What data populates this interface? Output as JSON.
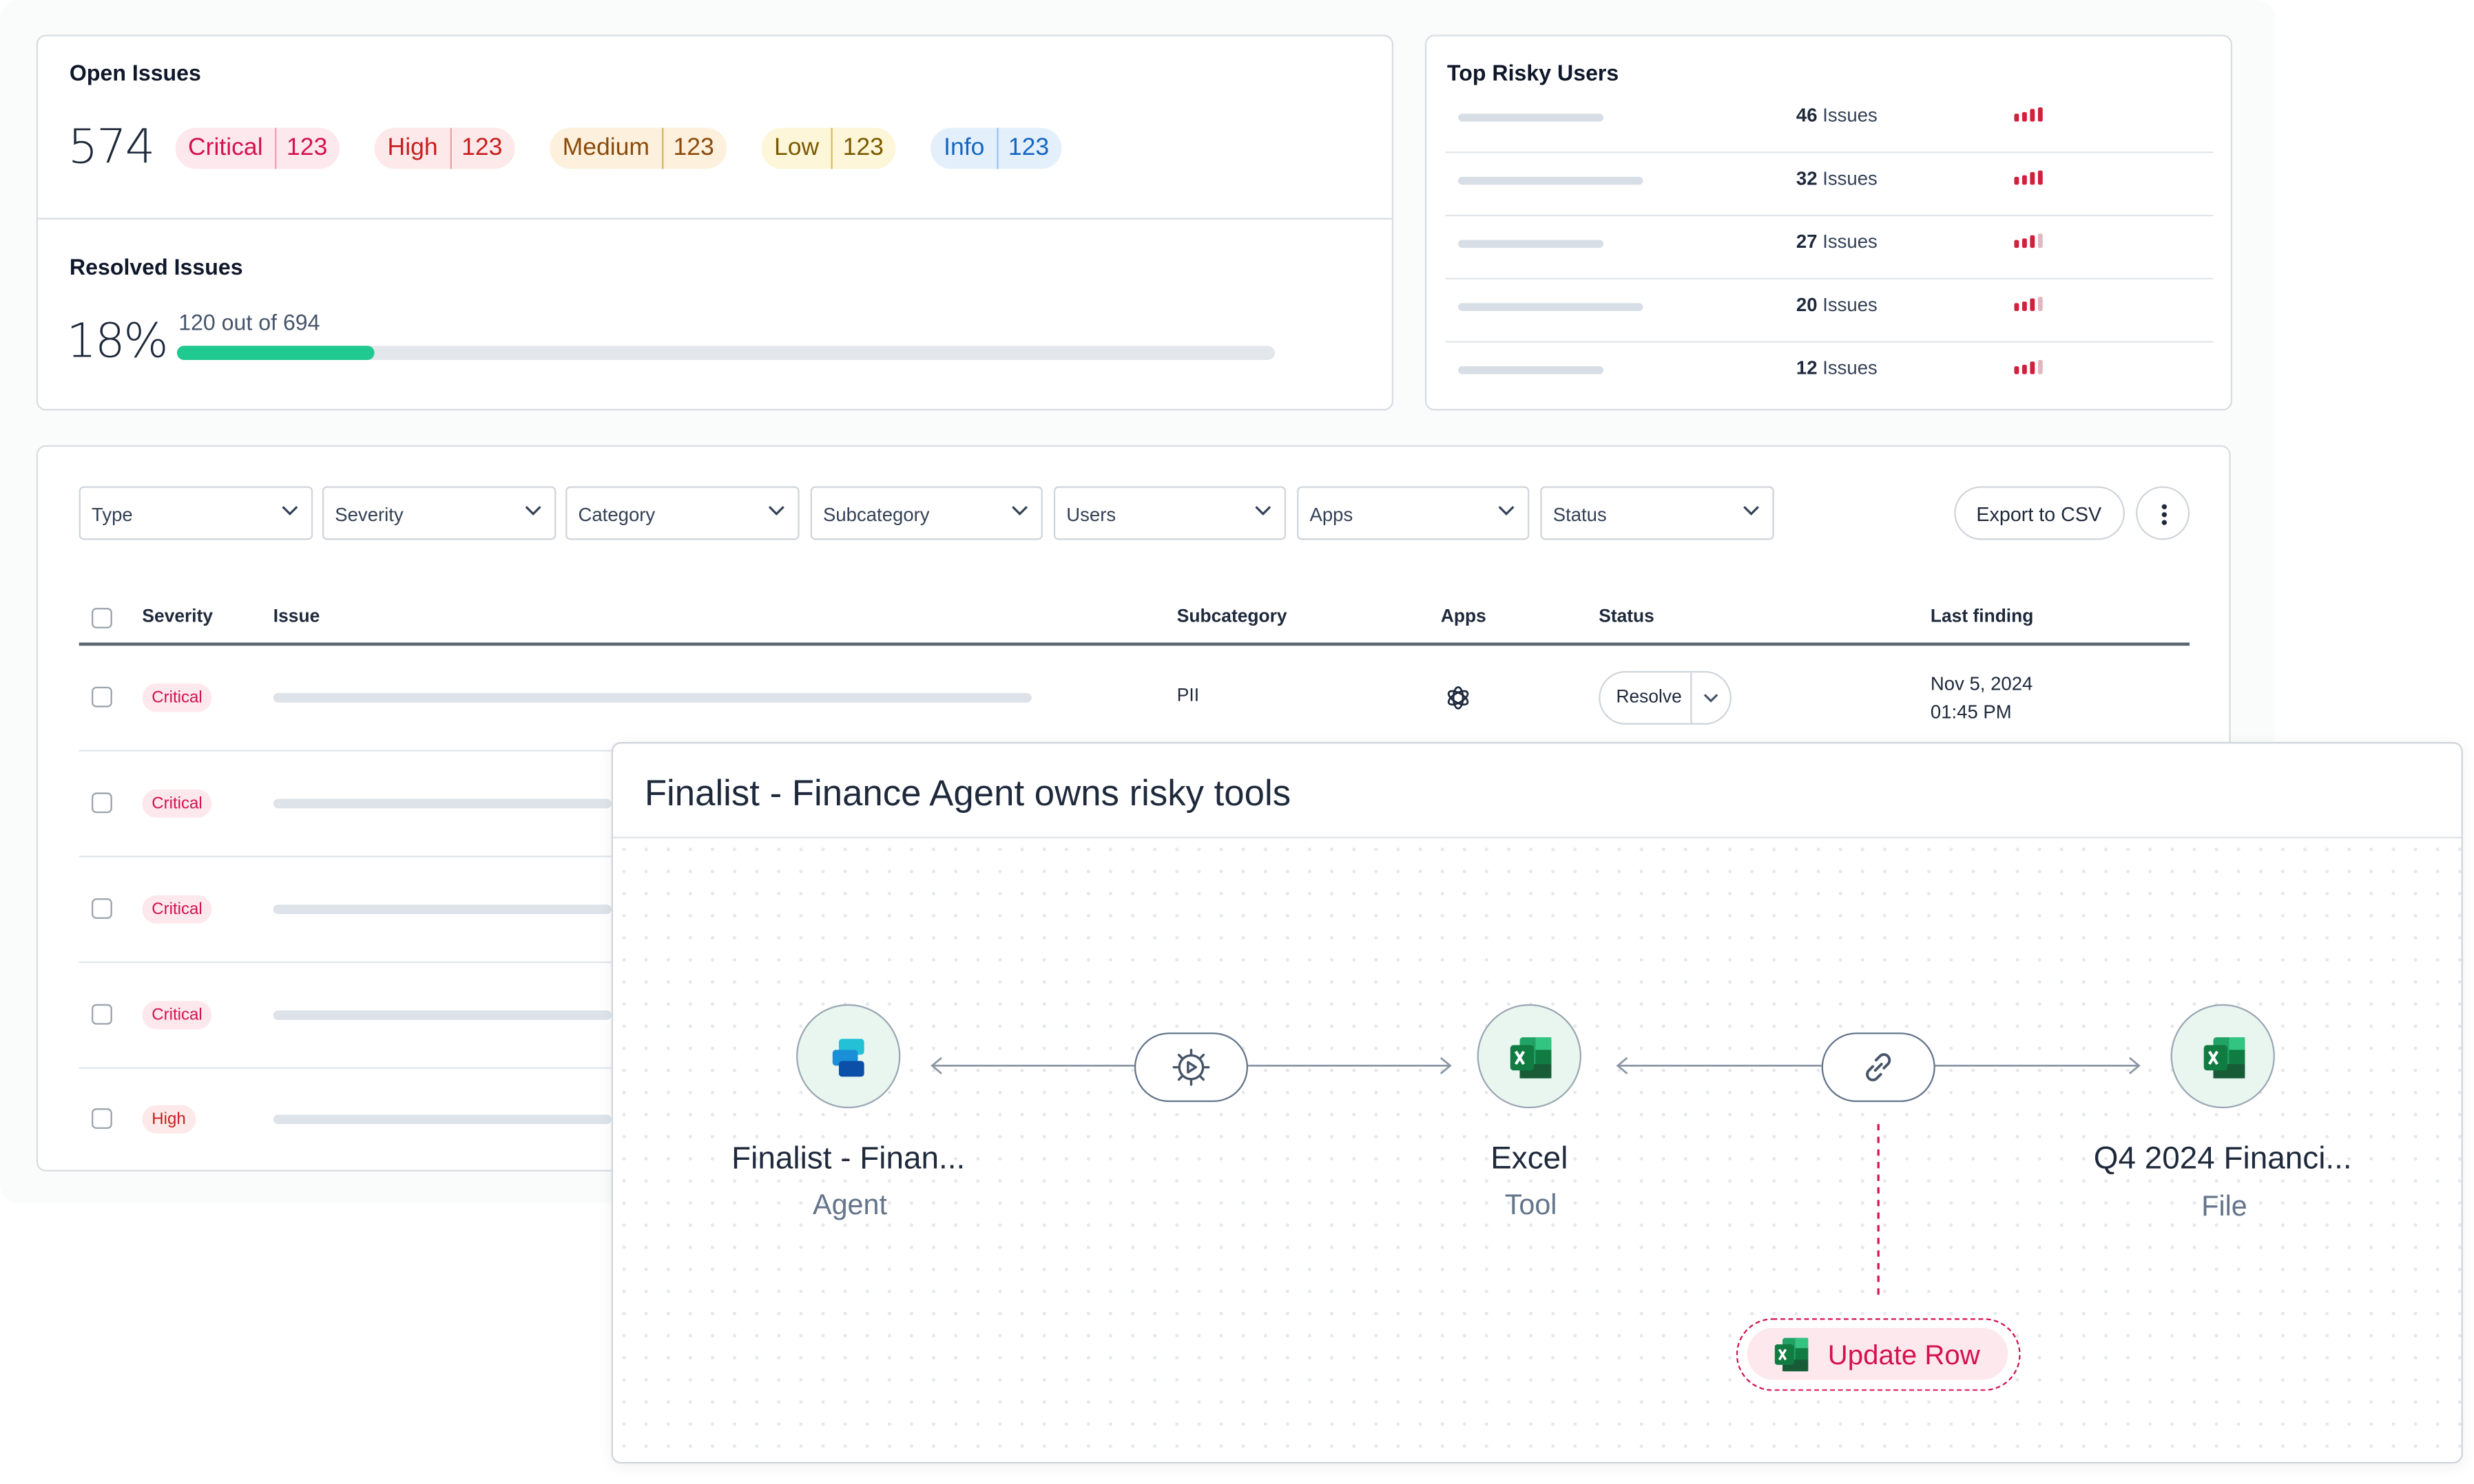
{
  "open_issues": {
    "title": "Open Issues",
    "total": "574",
    "badges": [
      {
        "label": "Critical",
        "count": "123",
        "bg": "#fde8ee",
        "fg": "#d4124e",
        "sep": "#e9a0b8"
      },
      {
        "label": "High",
        "count": "123",
        "bg": "#fde9e9",
        "fg": "#c81e1e",
        "sep": "#eaa3a3"
      },
      {
        "label": "Medium",
        "count": "123",
        "bg": "#fdf0dc",
        "fg": "#8a4b0b",
        "sep": "#d6b06f"
      },
      {
        "label": "Low",
        "count": "123",
        "bg": "#fdf6d8",
        "fg": "#7a5a00",
        "sep": "#d6bf5c"
      },
      {
        "label": "Info",
        "count": "123",
        "bg": "#e3f0fb",
        "fg": "#1565c0",
        "sep": "#9cc4ea"
      }
    ]
  },
  "resolved_issues": {
    "title": "Resolved Issues",
    "percent_label": "18%",
    "progress_text": "120 out of 694",
    "progress_fraction": 0.18
  },
  "top_risky_users": {
    "title": "Top Risky Users",
    "unit": "Issues",
    "rows": [
      {
        "count": "46",
        "bar_fraction": 0.47,
        "level": 4
      },
      {
        "count": "32",
        "bar_fraction": 0.6,
        "level": 4
      },
      {
        "count": "27",
        "bar_fraction": 0.47,
        "level": 3
      },
      {
        "count": "20",
        "bar_fraction": 0.6,
        "level": 3
      },
      {
        "count": "12",
        "bar_fraction": 0.47,
        "level": 3
      }
    ]
  },
  "filters": [
    "Type",
    "Severity",
    "Category",
    "Subcategory",
    "Users",
    "Apps",
    "Status"
  ],
  "actions": {
    "export": "Export to CSV",
    "more_icon": "vertical-ellipsis-icon"
  },
  "table": {
    "headers": {
      "severity": "Severity",
      "issue": "Issue",
      "subcategory": "Subcategory",
      "apps": "Apps",
      "status": "Status",
      "last_finding": "Last finding"
    },
    "rows": [
      {
        "severity": "Critical",
        "subcategory": "PII",
        "app_icon": "openai-icon",
        "status_action": "Resolve",
        "date": "Nov 5, 2024",
        "time": "01:45 PM",
        "issue_bar_fraction": 1.0
      },
      {
        "severity": "Critical",
        "issue_bar_fraction": 1.0
      },
      {
        "severity": "Critical",
        "issue_bar_fraction": 1.0
      },
      {
        "severity": "Critical",
        "issue_bar_fraction": 1.0
      },
      {
        "severity": "High",
        "issue_bar_fraction": 1.0
      }
    ]
  },
  "severity_colors": {
    "Critical": {
      "bg": "#fde8ee",
      "fg": "#d4124e"
    },
    "High": {
      "bg": "#fde9e9",
      "fg": "#c81e1e"
    }
  },
  "graph": {
    "title": "Finalist - Finance Agent owns risky tools",
    "nodes": [
      {
        "name": "Finalist - Finan...",
        "type": "Agent",
        "icon": "copilot-studio-icon"
      },
      {
        "name": "Excel",
        "type": "Tool",
        "icon": "excel-icon"
      },
      {
        "name": "Q4 2024 Financi...",
        "type": "File",
        "icon": "excel-file-icon"
      }
    ],
    "connectors": [
      {
        "icon": "gear-play-icon"
      },
      {
        "icon": "link-icon"
      }
    ],
    "action": {
      "label": "Update Row",
      "icon": "excel-icon",
      "color": "#d4124e"
    }
  }
}
